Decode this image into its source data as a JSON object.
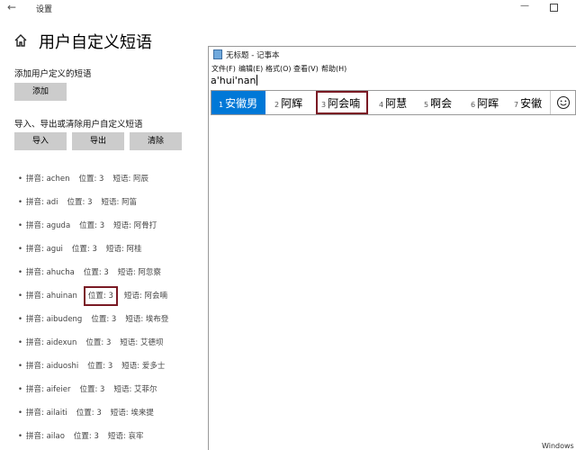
{
  "settings": {
    "window_title": "设置",
    "page_title": "用户自定义短语",
    "add_section_label": "添加用户定义的短语",
    "add_button": "添加",
    "io_section_label": "导入、导出或清除用户自定义短语",
    "import_button": "导入",
    "export_button": "导出",
    "clear_button": "清除",
    "phrases": [
      {
        "pinyin": "拼音: achen",
        "position": "位置: 3",
        "phrase": "短语: 阿辰"
      },
      {
        "pinyin": "拼音: adi",
        "position": "位置: 3",
        "phrase": "短语: 阿笛"
      },
      {
        "pinyin": "拼音: aguda",
        "position": "位置: 3",
        "phrase": "短语: 阿骨打"
      },
      {
        "pinyin": "拼音: agui",
        "position": "位置: 3",
        "phrase": "短语: 阿桂"
      },
      {
        "pinyin": "拼音: ahucha",
        "position": "位置: 3",
        "phrase": "短语: 阿忽察"
      },
      {
        "pinyin": "拼音: ahuinan",
        "position": "位置: 3",
        "phrase": "短语: 阿会喃"
      },
      {
        "pinyin": "拼音: aibudeng",
        "position": "位置: 3",
        "phrase": "短语: 埃布登"
      },
      {
        "pinyin": "拼音: aidexun",
        "position": "位置: 3",
        "phrase": "短语: 艾德坝"
      },
      {
        "pinyin": "拼音: aiduoshi",
        "position": "位置: 3",
        "phrase": "短语: 爱多士"
      },
      {
        "pinyin": "拼音: aifeier",
        "position": "位置: 3",
        "phrase": "短语: 艾菲尔"
      },
      {
        "pinyin": "拼音: ailaiti",
        "position": "位置: 3",
        "phrase": "短语: 埃来提"
      },
      {
        "pinyin": "拼音: ailao",
        "position": "位置: 3",
        "phrase": "短语: 哀牢"
      }
    ]
  },
  "notepad": {
    "title": "无标题 - 记事本",
    "menus": [
      "文件(F)",
      "编辑(E)",
      "格式(O)",
      "查看(V)",
      "帮助(H)"
    ],
    "text": "a'hui'nan",
    "candidates": [
      {
        "num": "1",
        "word": "安徽男"
      },
      {
        "num": "2",
        "word": "阿辉"
      },
      {
        "num": "3",
        "word": "阿会喃"
      },
      {
        "num": "4",
        "word": "阿慧"
      },
      {
        "num": "5",
        "word": "啊会"
      },
      {
        "num": "6",
        "word": "阿晖"
      },
      {
        "num": "7",
        "word": "安徽"
      }
    ],
    "emoji_glyph": "☺"
  },
  "taskbar": {
    "label": "Windows"
  }
}
